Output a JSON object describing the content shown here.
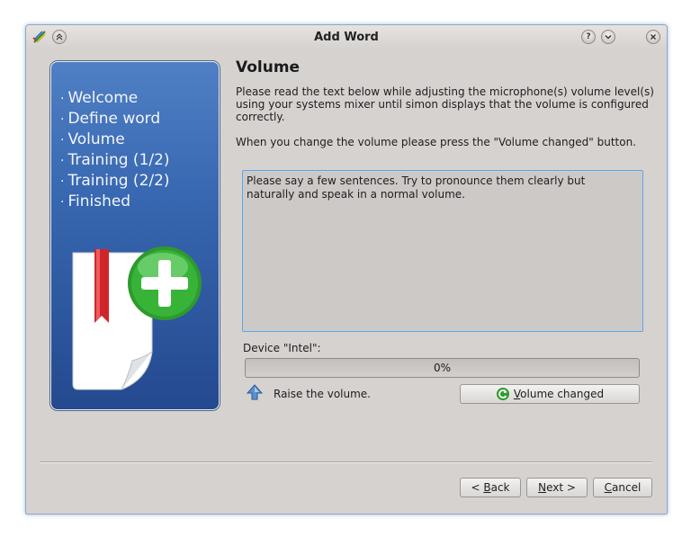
{
  "window": {
    "title": "Add Word"
  },
  "titlebar": {
    "help_glyph": "?",
    "minimize_glyph": "v",
    "close_glyph": "x",
    "shade_glyph": "^"
  },
  "sidebar": {
    "steps": [
      "Welcome",
      "Define word",
      "Volume",
      "Training (1/2)",
      "Training (2/2)",
      "Finished"
    ],
    "bullet": "·"
  },
  "main": {
    "heading": "Volume",
    "instructions": "Please read the text below while adjusting the microphone(s) volume level(s) using your systems mixer until simon displays that the volume is configured correctly.",
    "note": "When you change the volume please press the \"Volume changed\" button.",
    "prompt_text": "Please say a few sentences. Try to pronounce them clearly but naturally and speak in a normal volume.",
    "device_label": "Device \"Intel\":",
    "progress": {
      "value": 0,
      "text": "0%"
    },
    "hint": "Raise the volume.",
    "volume_button": {
      "label": "Volume changed",
      "mnemonic": "V",
      "rest": "olume changed"
    }
  },
  "footer": {
    "back": {
      "prefix": "< ",
      "mnemonic": "B",
      "rest": "ack"
    },
    "next": {
      "mnemonic": "N",
      "rest": "ext >"
    },
    "cancel": {
      "mnemonic": "C",
      "rest": "ancel"
    }
  },
  "colors": {
    "accent": "#6fa0cf",
    "sidebar": "#3767b0"
  }
}
